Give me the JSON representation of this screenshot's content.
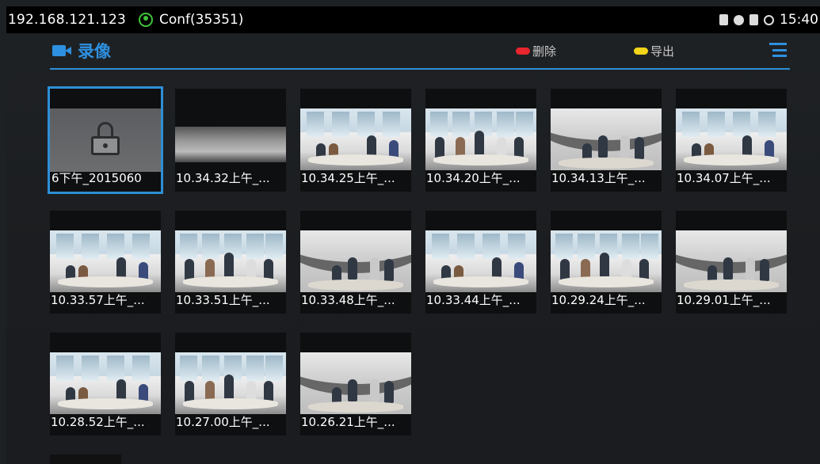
{
  "statusbar": {
    "ip": "192.168.121.123",
    "conf": "Conf(35351)",
    "time": "15:40",
    "icons": [
      "sd-card-icon",
      "bluetooth-icon",
      "sim-icon",
      "sync-ring-icon"
    ]
  },
  "header": {
    "title": "录像",
    "delete_label": "删除",
    "export_label": "导出",
    "accent": "#2e90e0",
    "delete_color": "#e8262d",
    "export_color": "#f2d51a"
  },
  "recordings": [
    {
      "label": "6下午_2015060",
      "kind": "locked",
      "selected": true
    },
    {
      "label": "10.34.32上午_...",
      "kind": "office"
    },
    {
      "label": "10.34.25上午_...",
      "kind": "meet-a"
    },
    {
      "label": "10.34.20上午_...",
      "kind": "meet-b"
    },
    {
      "label": "10.34.13上午_...",
      "kind": "curve"
    },
    {
      "label": "10.34.07上午_...",
      "kind": "meet-a"
    },
    {
      "label": "10.33.57上午_...",
      "kind": "meet-a"
    },
    {
      "label": "10.33.51上午_...",
      "kind": "meet-b"
    },
    {
      "label": "10.33.48上午_...",
      "kind": "curve"
    },
    {
      "label": "10.33.44上午_...",
      "kind": "meet-a"
    },
    {
      "label": "10.29.24上午_...",
      "kind": "meet-b"
    },
    {
      "label": "10.29.01上午_...",
      "kind": "curve"
    },
    {
      "label": "10.28.52上午_...",
      "kind": "meet-a"
    },
    {
      "label": "10.27.00上午_...",
      "kind": "meet-b"
    },
    {
      "label": "10.26.21上午_...",
      "kind": "curve"
    }
  ]
}
